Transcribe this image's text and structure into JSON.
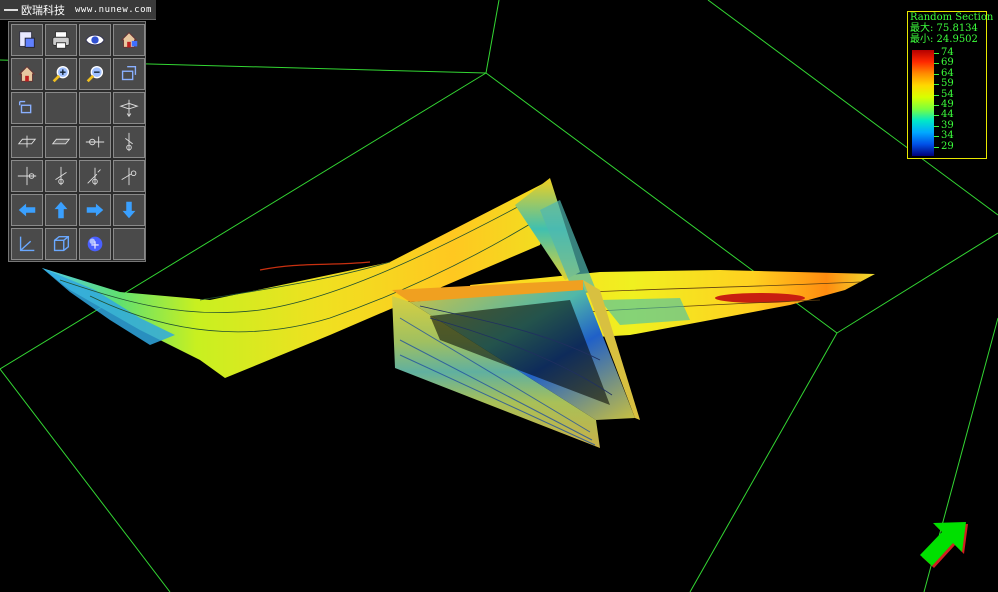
{
  "header": {
    "company": "欧瑞科技",
    "url": "www.nunew.com"
  },
  "toolbar": {
    "buttons": [
      {
        "icon": "save-section-icon"
      },
      {
        "icon": "print-icon"
      },
      {
        "icon": "view-eye-icon"
      },
      {
        "icon": "home-view-icon"
      },
      {
        "icon": "home-icon"
      },
      {
        "icon": "zoom-in-icon"
      },
      {
        "icon": "zoom-out-icon"
      },
      {
        "icon": "fit-view-icon"
      },
      {
        "icon": "rotate-view-icon"
      },
      {
        "icon": ""
      },
      {
        "icon": ""
      },
      {
        "icon": "slice-vertical-icon"
      },
      {
        "icon": "slice-plane-icon"
      },
      {
        "icon": "slice-flat-icon"
      },
      {
        "icon": "rotate-axis-x-icon"
      },
      {
        "icon": "rotate-axis-y-icon"
      },
      {
        "icon": "rotate-axis-z-icon"
      },
      {
        "icon": "rotate-axis-neg-z-icon"
      },
      {
        "icon": "rotate-axis-xy-icon"
      },
      {
        "icon": "rotate-axis-yz-icon"
      },
      {
        "icon": "arrow-left-icon"
      },
      {
        "icon": "arrow-up-icon"
      },
      {
        "icon": "arrow-right-icon"
      },
      {
        "icon": "arrow-down-icon"
      },
      {
        "icon": "axes-icon"
      },
      {
        "icon": "cube-icon"
      },
      {
        "icon": "sphere-icon"
      },
      {
        "icon": ""
      }
    ]
  },
  "legend": {
    "title": "Random Section",
    "max_line": "最大: 75.8134",
    "min_line": "最小: 24.9502",
    "ticks": [
      "74",
      "69",
      "64",
      "59",
      "54",
      "49",
      "44",
      "39",
      "34",
      "29"
    ],
    "colors": [
      "#b40000",
      "#ff2800",
      "#ff8c00",
      "#ffd800",
      "#d8ff00",
      "#7cff3c",
      "#00e8c8",
      "#00a8ff",
      "#0050e8",
      "#000078"
    ]
  },
  "scene": {
    "grid_color": "#33d633",
    "orientation_arrow_color": "#00e000"
  }
}
